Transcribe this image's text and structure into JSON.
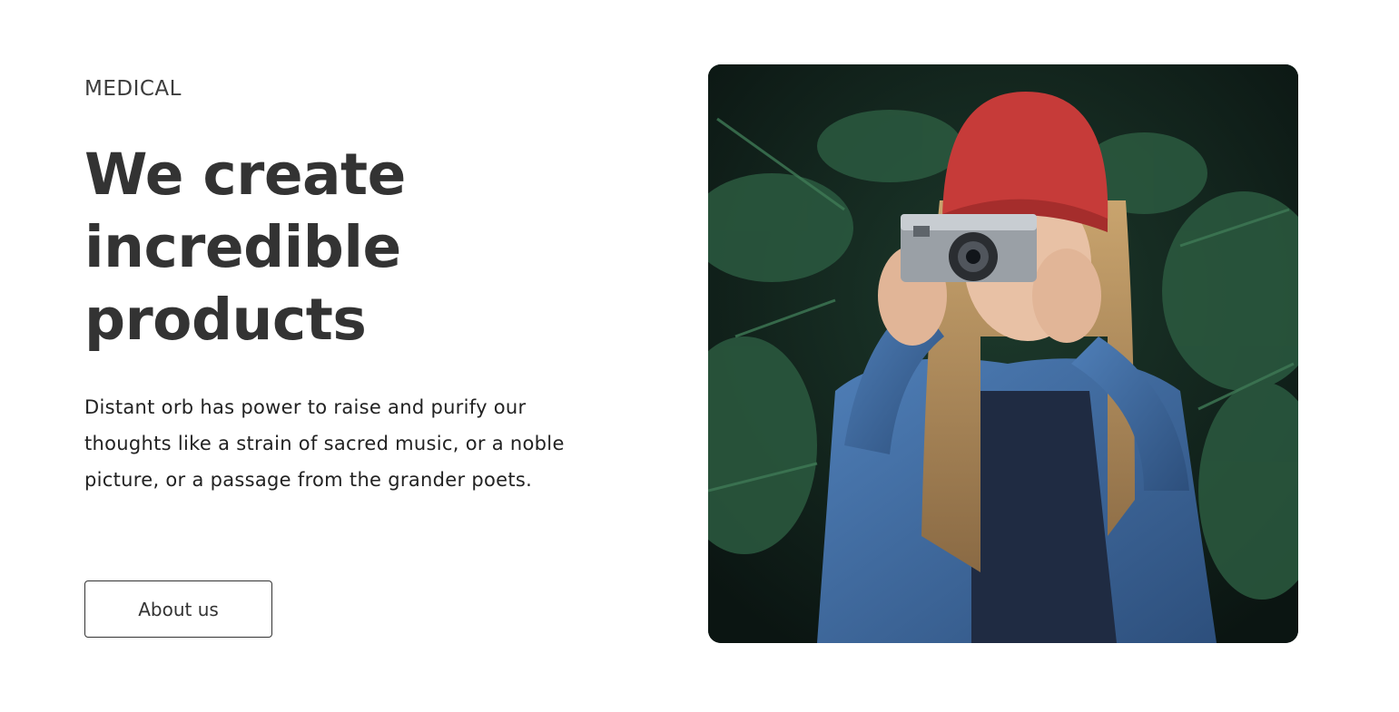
{
  "hero": {
    "eyebrow": "MEDICAL",
    "headline": "We create incredible products",
    "description": "Distant orb has power to raise and purify our thoughts like a strain of sacred music, or a noble picture, or a passage from the grander poets.",
    "cta_label": "About us"
  }
}
